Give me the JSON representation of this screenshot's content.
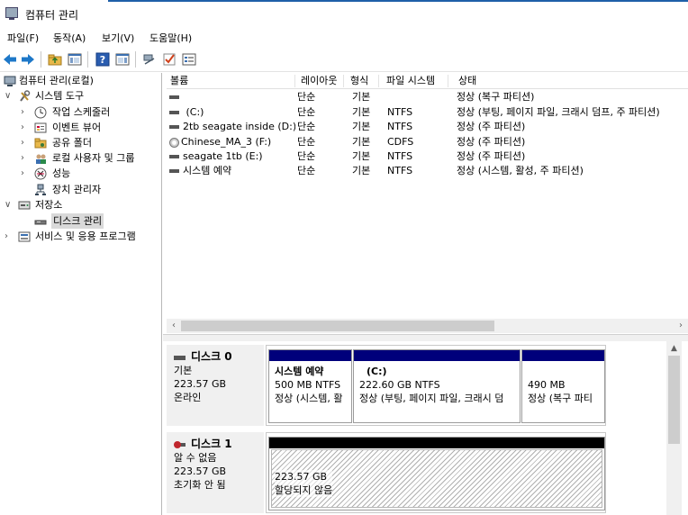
{
  "window": {
    "title": "컴퓨터 관리"
  },
  "menu": [
    "파일(F)",
    "동작(A)",
    "보기(V)",
    "도움말(H)"
  ],
  "toolbar": {
    "icons": [
      "back-icon",
      "forward-icon",
      "up-folder-icon",
      "show-tree-icon",
      "help-icon",
      "action-pane-icon",
      "connect-icon",
      "check-icon",
      "properties-icon"
    ]
  },
  "tree": {
    "root": "컴퓨터 관리(로컬)",
    "system_tools": "시스템 도구",
    "task_scheduler": "작업 스케줄러",
    "event_viewer": "이벤트 뷰어",
    "shared_folders": "공유 폴더",
    "local_users": "로컬 사용자 및 그룹",
    "performance": "성능",
    "device_manager": "장치 관리자",
    "storage": "저장소",
    "disk_management": "디스크 관리",
    "services": "서비스 및 응용 프로그램"
  },
  "volume_list": {
    "columns": [
      "볼륨",
      "레이아웃",
      "형식",
      "파일 시스템",
      "상태"
    ],
    "rows": [
      {
        "volume": "",
        "layout": "단순",
        "type": "기본",
        "fs": "",
        "status": "정상 (복구 파티션)",
        "icon": "volume"
      },
      {
        "volume": "(C:)",
        "layout": "단순",
        "type": "기본",
        "fs": "NTFS",
        "status": "정상 (부팅, 페이지 파일, 크래시 덤프, 주 파티션)",
        "icon": "volume"
      },
      {
        "volume": "2tb seagate inside (D:)",
        "layout": "단순",
        "type": "기본",
        "fs": "NTFS",
        "status": "정상 (주 파티션)",
        "icon": "volume"
      },
      {
        "volume": "Chinese_MA_3 (F:)",
        "layout": "단순",
        "type": "기본",
        "fs": "CDFS",
        "status": "정상 (주 파티션)",
        "icon": "cd"
      },
      {
        "volume": "seagate 1tb (E:)",
        "layout": "단순",
        "type": "기본",
        "fs": "NTFS",
        "status": "정상 (주 파티션)",
        "icon": "volume"
      },
      {
        "volume": "시스템 예약",
        "layout": "단순",
        "type": "기본",
        "fs": "NTFS",
        "status": "정상 (시스템, 활성, 주 파티션)",
        "icon": "volume"
      }
    ]
  },
  "disks": {
    "disk0": {
      "name": "디스크 0",
      "type": "기본",
      "size": "223.57 GB",
      "state": "온라인",
      "partitions": [
        {
          "name": "시스템 예약",
          "size": "500 MB NTFS",
          "status": "정상 (시스템, 활"
        },
        {
          "name": "(C:)",
          "size": "222.60 GB NTFS",
          "status": "정상 (부팅, 페이지 파일, 크래시 덤"
        },
        {
          "name": "",
          "size": "490 MB",
          "status": "정상 (복구 파티"
        }
      ]
    },
    "disk1": {
      "name": "디스크 1",
      "type": "알 수 없음",
      "size": "223.57 GB",
      "state": "초기화 안 됨",
      "unallocated": {
        "size": "223.57 GB",
        "label": "할당되지 않음"
      }
    }
  },
  "colors": {
    "primary_partition": "#00007b",
    "unallocated": "#000000",
    "error": "#c0262d"
  }
}
